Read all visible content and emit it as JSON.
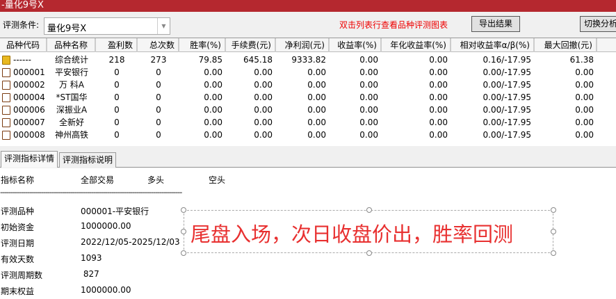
{
  "window": {
    "title": "-量化9号X"
  },
  "toolbar": {
    "cond_label": "评测条件:",
    "cond_value": "量化9号X",
    "hint": "双击列表行查看品种评测图表",
    "export": "导出结果",
    "switch": "切换分析"
  },
  "table": {
    "headers": [
      "品种代码",
      "品种名称",
      "盈利数",
      "总次数",
      "胜率(%)",
      "手续费(元)",
      "净利润(元)",
      "收益率(%)",
      "年化收益率(%)",
      "相对收益率α/β(%)",
      "最大回撤(元)",
      "最"
    ],
    "rows": [
      [
        "------",
        "综合统计",
        "218",
        "273",
        "79.85",
        "645.18",
        "9333.82",
        "0.00",
        "0.00",
        "0.16/-17.95",
        "61.38"
      ],
      [
        "000001",
        "平安银行",
        "0",
        "0",
        "0.00",
        "0.00",
        "0.00",
        "0.00",
        "0.00",
        "0.00/-17.95",
        "0.00"
      ],
      [
        "000002",
        "万 科A",
        "0",
        "0",
        "0.00",
        "0.00",
        "0.00",
        "0.00",
        "0.00",
        "0.00/-17.95",
        "0.00"
      ],
      [
        "000004",
        "*ST国华",
        "0",
        "0",
        "0.00",
        "0.00",
        "0.00",
        "0.00",
        "0.00",
        "0.00/-17.95",
        "0.00"
      ],
      [
        "000006",
        "深振业A",
        "0",
        "0",
        "0.00",
        "0.00",
        "0.00",
        "0.00",
        "0.00",
        "0.00/-17.95",
        "0.00"
      ],
      [
        "000007",
        "全新好",
        "0",
        "0",
        "0.00",
        "0.00",
        "0.00",
        "0.00",
        "0.00",
        "0.00/-17.95",
        "0.00"
      ],
      [
        "000008",
        "神州高铁",
        "0",
        "0",
        "0.00",
        "0.00",
        "0.00",
        "0.00",
        "0.00",
        "0.00/-17.95",
        "0.00"
      ]
    ]
  },
  "tabs": [
    "评测指标详情",
    "评测指标说明"
  ],
  "detail": {
    "headers": [
      "指标名称",
      "全部交易",
      "多头",
      "空头"
    ],
    "separator": "----------------------------------------------------------------------------------------",
    "items": [
      {
        "label": "评测品种",
        "value": "000001-平安银行"
      },
      {
        "label": "初始资金",
        "value": "1000000.00"
      },
      {
        "label": "评测日期",
        "value": "2022/12/05-2025/12/03"
      },
      {
        "label": "有效天数",
        "value": "1093"
      },
      {
        "label": "评测周期数",
        "value": " 827"
      },
      {
        "label": "期末权益",
        "value": "1000000.00"
      }
    ]
  },
  "annotation": {
    "text": "尾盘入场，次日收盘价出，胜率回测",
    "color": "#e83030"
  }
}
